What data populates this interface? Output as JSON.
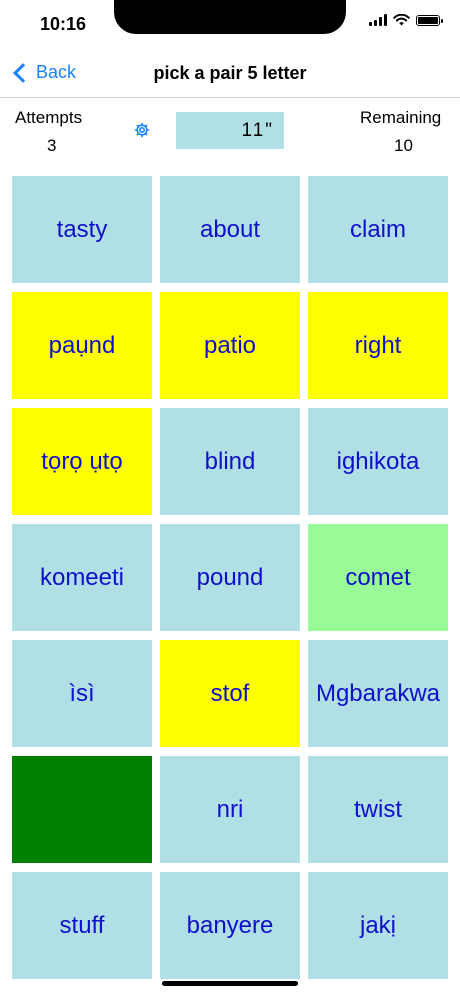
{
  "status": {
    "time": "10:16"
  },
  "nav": {
    "back_label": "Back",
    "title": "pick a pair 5 letter"
  },
  "stats": {
    "attempts_label": "Attempts",
    "attempts_value": "3",
    "timer": "11\"",
    "remaining_label": "Remaining",
    "remaining_value": "10"
  },
  "colors": {
    "hidden": "#b0dfe5",
    "flipped": "#ffff00",
    "selected": "#98fb98",
    "matched": "#008000",
    "word_text": "#1010cc",
    "accent": "#1a82fb"
  },
  "tiles": [
    {
      "word": "tasty",
      "state": "hidden"
    },
    {
      "word": "about",
      "state": "hidden"
    },
    {
      "word": "claim",
      "state": "hidden"
    },
    {
      "word": "paụnd",
      "state": "flipped"
    },
    {
      "word": "patio",
      "state": "flipped"
    },
    {
      "word": "right",
      "state": "flipped"
    },
    {
      "word": "tọrọ ụtọ",
      "state": "flipped"
    },
    {
      "word": "blind",
      "state": "hidden"
    },
    {
      "word": "ighikota",
      "state": "hidden"
    },
    {
      "word": "komeeti",
      "state": "hidden"
    },
    {
      "word": "pound",
      "state": "hidden"
    },
    {
      "word": "comet",
      "state": "selected"
    },
    {
      "word": "ìsì",
      "state": "hidden"
    },
    {
      "word": "stof",
      "state": "flipped"
    },
    {
      "word": "Mgbarakwa",
      "state": "hidden"
    },
    {
      "word": "",
      "state": "matched"
    },
    {
      "word": "nri",
      "state": "hidden"
    },
    {
      "word": "twist",
      "state": "hidden"
    },
    {
      "word": "stuff",
      "state": "hidden"
    },
    {
      "word": "banyere",
      "state": "hidden"
    },
    {
      "word": "jakị",
      "state": "hidden"
    }
  ]
}
